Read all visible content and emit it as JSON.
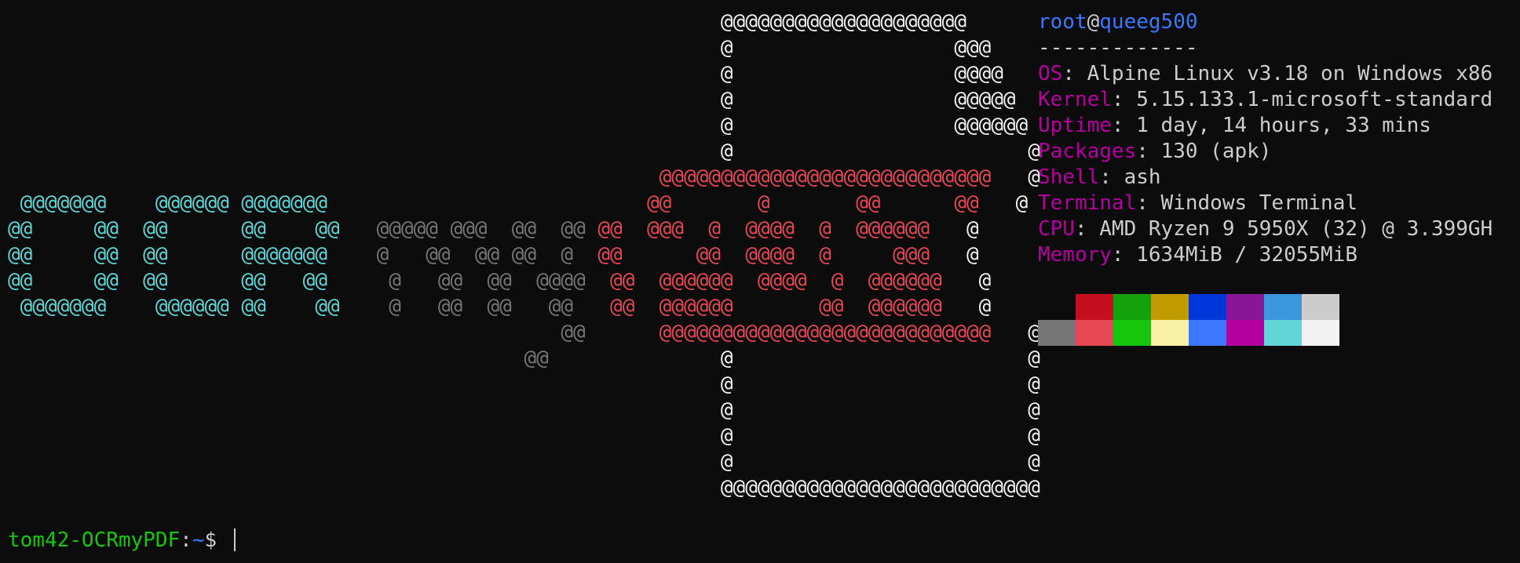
{
  "colors": {
    "background": "#0c0c0c",
    "foreground": "#cccccc",
    "cyan": "#61d6d6",
    "gray": "#767676",
    "red": "#e74856",
    "white": "#f2f2f2",
    "key": "#b4009e",
    "host": "#3b78ff",
    "prompt_user": "#16c60c",
    "prompt_path": "#3b78ff",
    "cursor": "#cccccc"
  },
  "logo": {
    "lines": [
      [
        {
          "t": "                                                          "
        },
        {
          "t": "@@@@@@@@@@@@@@@@@@@@",
          "c": "white"
        }
      ],
      [
        {
          "t": "                                                          "
        },
        {
          "t": "@                  @@@",
          "c": "white"
        }
      ],
      [
        {
          "t": "                                                          "
        },
        {
          "t": "@                  @@@@",
          "c": "white"
        }
      ],
      [
        {
          "t": "                                                          "
        },
        {
          "t": "@                  @@@@@",
          "c": "white"
        }
      ],
      [
        {
          "t": "                                                          "
        },
        {
          "t": "@                  @@@@@@",
          "c": "white"
        }
      ],
      [
        {
          "t": "                                                          "
        },
        {
          "t": "@                        @",
          "c": "white"
        }
      ],
      [
        {
          "t": "                                                     "
        },
        {
          "t": "@@@@@@@@@@@@@@@@@@@@@@@@@@@",
          "c": "red"
        },
        {
          "t": "   "
        },
        {
          "t": "@",
          "c": "white"
        }
      ],
      [
        {
          "t": " @@@@@@@    @@@@@@ @@@@@@@",
          "c": "cyan"
        },
        {
          "t": "                          "
        },
        {
          "t": "@@       @       @@      @@",
          "c": "red"
        },
        {
          "t": "   "
        },
        {
          "t": "@",
          "c": "white"
        }
      ],
      [
        {
          "t": "@@     @@  @@      @@    @@",
          "c": "cyan"
        },
        {
          "t": "   "
        },
        {
          "t": "@@@@@ @@@  @@  @@",
          "c": "gray"
        },
        {
          "t": " "
        },
        {
          "t": "@@  @@@  @  @@@@  @  @@@@@@",
          "c": "red"
        },
        {
          "t": "   "
        },
        {
          "t": "@",
          "c": "white"
        }
      ],
      [
        {
          "t": "@@     @@  @@      @@@@@@@",
          "c": "cyan"
        },
        {
          "t": "    "
        },
        {
          "t": "@   @@  @@ @@  @",
          "c": "gray"
        },
        {
          "t": "  "
        },
        {
          "t": "@@      @@  @@@@  @     @@@",
          "c": "red"
        },
        {
          "t": "   "
        },
        {
          "t": "@",
          "c": "white"
        }
      ],
      [
        {
          "t": "@@     @@  @@      @@   @@",
          "c": "cyan"
        },
        {
          "t": "     "
        },
        {
          "t": "@   @@  @@  @@@@",
          "c": "gray"
        },
        {
          "t": "  "
        },
        {
          "t": "@@  @@@@@@  @@@@  @  @@@@@@",
          "c": "red"
        },
        {
          "t": "   "
        },
        {
          "t": "@",
          "c": "white"
        }
      ],
      [
        {
          "t": " @@@@@@@    @@@@@@ @@    @@",
          "c": "cyan"
        },
        {
          "t": "    "
        },
        {
          "t": "@   @@  @@   @@",
          "c": "gray"
        },
        {
          "t": "   "
        },
        {
          "t": "@@  @@@@@@       @@  @@@@@@",
          "c": "red"
        },
        {
          "t": "   "
        },
        {
          "t": "@",
          "c": "white"
        }
      ],
      [
        {
          "t": "                                             "
        },
        {
          "t": "@@",
          "c": "gray"
        },
        {
          "t": "      "
        },
        {
          "t": "@@@@@@@@@@@@@@@@@@@@@@@@@@@",
          "c": "red"
        },
        {
          "t": "   "
        },
        {
          "t": "@",
          "c": "white"
        }
      ],
      [
        {
          "t": "                                          "
        },
        {
          "t": "@@",
          "c": "gray"
        },
        {
          "t": "              "
        },
        {
          "t": "@                        @",
          "c": "white"
        }
      ],
      [
        {
          "t": "                                                          "
        },
        {
          "t": "@                        @",
          "c": "white"
        }
      ],
      [
        {
          "t": "                                                          "
        },
        {
          "t": "@                        @",
          "c": "white"
        }
      ],
      [
        {
          "t": "                                                          "
        },
        {
          "t": "@                        @",
          "c": "white"
        }
      ],
      [
        {
          "t": "                                                          "
        },
        {
          "t": "@                        @",
          "c": "white"
        }
      ],
      [
        {
          "t": "                                                          "
        },
        {
          "t": "@@@@@@@@@@@@@@@@@@@@@@@@@@",
          "c": "white"
        }
      ]
    ]
  },
  "info": {
    "user": "root",
    "at": "@",
    "host": "queeg500",
    "separator": "-------------",
    "rows": [
      {
        "key": "OS",
        "value": "Alpine Linux v3.18 on Windows x86"
      },
      {
        "key": "Kernel",
        "value": "5.15.133.1-microsoft-standard"
      },
      {
        "key": "Uptime",
        "value": "1 day, 14 hours, 33 mins"
      },
      {
        "key": "Packages",
        "value": "130 (apk)"
      },
      {
        "key": "Shell",
        "value": "ash"
      },
      {
        "key": "Terminal",
        "value": "Windows Terminal"
      },
      {
        "key": "CPU",
        "value": "AMD Ryzen 9 5950X (32) @ 3.399GH"
      },
      {
        "key": "Memory",
        "value": "1634MiB / 32055MiB"
      }
    ]
  },
  "palette": {
    "normal": [
      "#0c0c0c",
      "#c50f1f",
      "#13a10e",
      "#c19c00",
      "#0037da",
      "#881798",
      "#3a96dd",
      "#cccccc"
    ],
    "bright": [
      "#767676",
      "#e74856",
      "#16c60c",
      "#f9f1a5",
      "#3b78ff",
      "#b4009e",
      "#61d6d6",
      "#f2f2f2"
    ]
  },
  "prompt": {
    "user_host": "tom42-OCRmyPDF",
    "colon": ":",
    "path": "~",
    "symbol": "$ "
  }
}
